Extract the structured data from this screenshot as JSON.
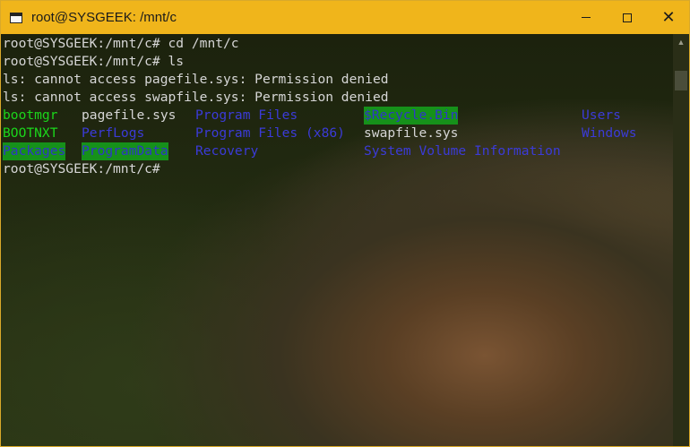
{
  "window": {
    "title": "root@SYSGEEK: /mnt/c",
    "icon": "terminal-icon",
    "controls": {
      "minimize": "minimize-icon",
      "maximize": "maximize-icon",
      "close": "✕"
    }
  },
  "terminal": {
    "lines": [
      "root@SYSGEEK:/mnt/c# cd /mnt/c",
      "root@SYSGEEK:/mnt/c# ls",
      "ls: cannot access pagefile.sys: Permission denied",
      "ls: cannot access swapfile.sys: Permission denied"
    ],
    "listing": {
      "row1": [
        "bootmgr",
        "pagefile.sys",
        "Program Files",
        "$Recycle.Bin",
        "Users"
      ],
      "row2": [
        "BOOTNXT",
        "PerfLogs",
        "Program Files (x86)",
        "swapfile.sys",
        "Windows"
      ],
      "row3": [
        "Packages",
        "ProgramData",
        "Recovery",
        "System Volume Information"
      ]
    },
    "prompt": "root@SYSGEEK:/mnt/c#"
  },
  "colors": {
    "titlebar": "#f0b51b",
    "directory": "#3b3bd8",
    "executable": "#1bd61b",
    "highlight": "#16911a"
  }
}
